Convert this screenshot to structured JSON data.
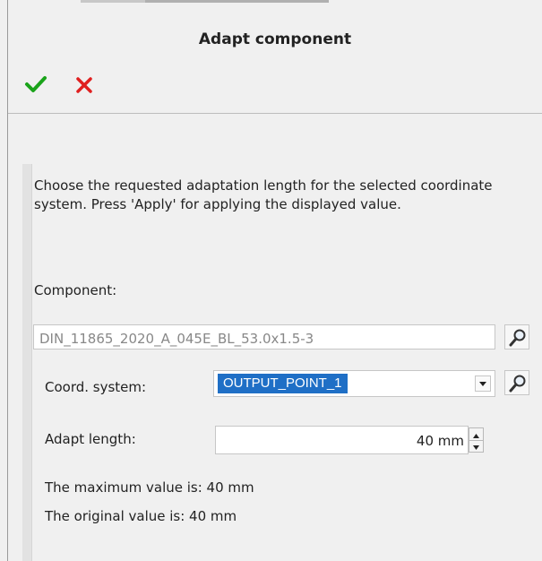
{
  "dialog": {
    "title": "Adapt component"
  },
  "toolbar": {
    "ok_icon": "check-icon",
    "cancel_icon": "close-icon",
    "colors": {
      "ok": "#1aa31a",
      "cancel": "#e02020"
    }
  },
  "form": {
    "description": "Choose the requested adaptation length for the selected coordinate system. Press 'Apply' for applying the displayed value.",
    "component": {
      "label": "Component:",
      "value": "DIN_11865_2020_A_045E_BL_53.0x1.5-3"
    },
    "coord_system": {
      "label": "Coord. system:",
      "value": "OUTPUT_POINT_1"
    },
    "adapt_length": {
      "label": "Adapt length:",
      "value": "40 mm"
    },
    "max_value_text": "The maximum value is: 40 mm",
    "original_value_text": "The original value is: 40 mm"
  },
  "colors": {
    "selection": "#1f6fc6"
  }
}
